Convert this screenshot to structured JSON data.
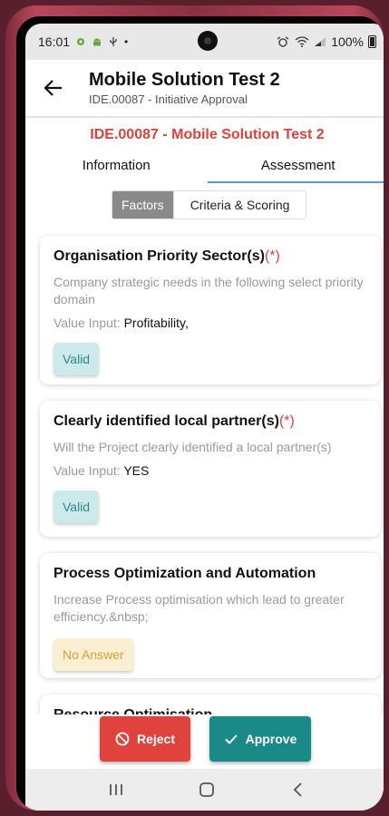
{
  "status_bar": {
    "time": "16:01",
    "dot": "•",
    "battery": "100%"
  },
  "app_bar": {
    "title": "Mobile Solution Test 2",
    "subtitle": "IDE.00087 - Initiative Approval"
  },
  "record_title": "IDE.00087 - Mobile Solution Test 2",
  "tabs": [
    {
      "label": "Information",
      "active": false
    },
    {
      "label": "Assessment",
      "active": true
    }
  ],
  "segments": [
    {
      "label": "Factors",
      "active": true
    },
    {
      "label": "Criteria & Scoring",
      "active": false
    }
  ],
  "factors": [
    {
      "title": "Organisation Priority Sector(s)",
      "required_mark": "(*)",
      "description": "Company strategic needs in the following select priority domain",
      "value_label": "Value Input: ",
      "value": "Profitability,",
      "status": "Valid"
    },
    {
      "title": "Clearly identified local partner(s)",
      "required_mark": "(*)",
      "description": "Will the Project clearly identified a local partner(s)",
      "value_label": "Value Input: ",
      "value": "YES",
      "status": "Valid"
    },
    {
      "title": "Process Optimization and Automation",
      "description": "Increase Process optimisation which lead to greater efficiency.&nbsp;",
      "status": "No Answer"
    },
    {
      "title": "Resource Optimisation"
    }
  ],
  "actions": {
    "reject_label": "Reject",
    "approve_label": "Approve"
  },
  "colors": {
    "accent_red": "#e0433e",
    "accent_teal": "#1a8a88",
    "valid_bg": "#cde9ec",
    "noanswer_bg": "#fbefd3"
  }
}
